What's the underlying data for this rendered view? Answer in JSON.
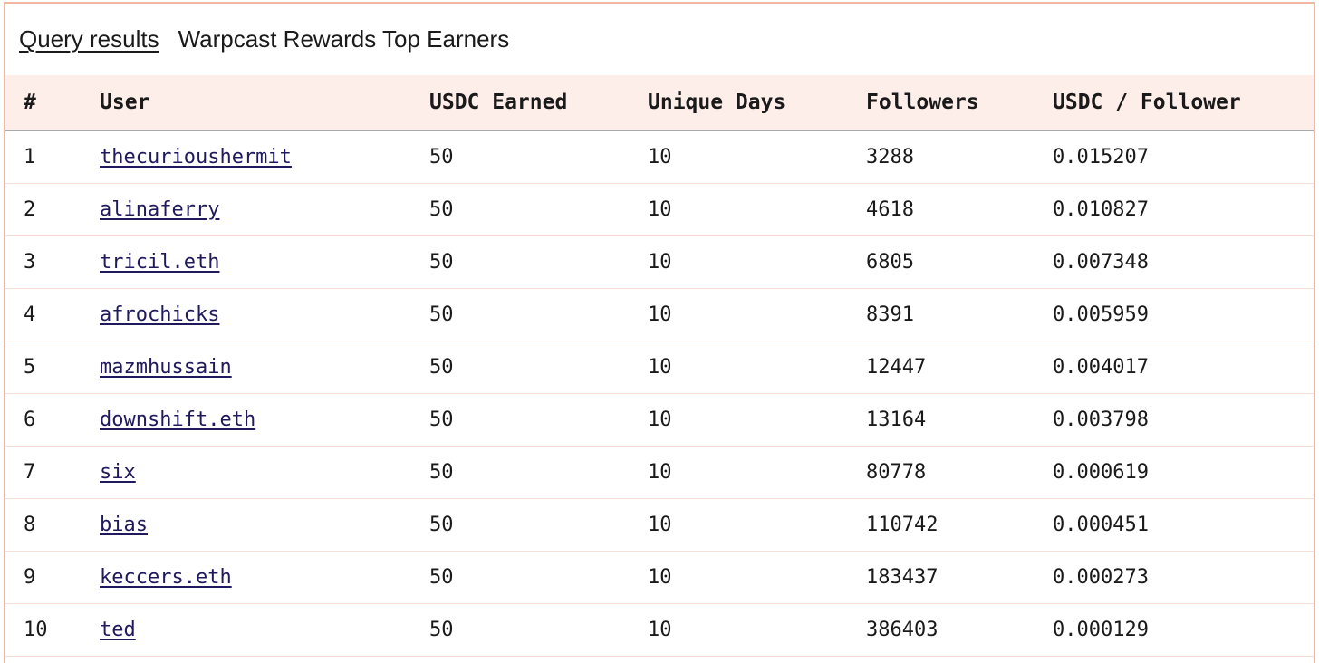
{
  "header": {
    "link_label": "Query results",
    "title": "Warpcast Rewards Top Earners"
  },
  "table": {
    "columns": [
      "#",
      "User",
      "USDC Earned",
      "Unique Days",
      "Followers",
      "USDC / Follower"
    ],
    "rows": [
      {
        "rank": "1",
        "user": "thecurioushermit",
        "usdc": "50",
        "days": "10",
        "followers": "3288",
        "ratio": "0.015207"
      },
      {
        "rank": "2",
        "user": "alinaferry",
        "usdc": "50",
        "days": "10",
        "followers": "4618",
        "ratio": "0.010827"
      },
      {
        "rank": "3",
        "user": "tricil.eth",
        "usdc": "50",
        "days": "10",
        "followers": "6805",
        "ratio": "0.007348"
      },
      {
        "rank": "4",
        "user": "afrochicks",
        "usdc": "50",
        "days": "10",
        "followers": "8391",
        "ratio": "0.005959"
      },
      {
        "rank": "5",
        "user": "mazmhussain",
        "usdc": "50",
        "days": "10",
        "followers": "12447",
        "ratio": "0.004017"
      },
      {
        "rank": "6",
        "user": "downshift.eth",
        "usdc": "50",
        "days": "10",
        "followers": "13164",
        "ratio": "0.003798"
      },
      {
        "rank": "7",
        "user": "six",
        "usdc": "50",
        "days": "10",
        "followers": "80778",
        "ratio": "0.000619"
      },
      {
        "rank": "8",
        "user": "bias",
        "usdc": "50",
        "days": "10",
        "followers": "110742",
        "ratio": "0.000451"
      },
      {
        "rank": "9",
        "user": "keccers.eth",
        "usdc": "50",
        "days": "10",
        "followers": "183437",
        "ratio": "0.000273"
      },
      {
        "rank": "10",
        "user": "ted",
        "usdc": "50",
        "days": "10",
        "followers": "386403",
        "ratio": "0.000129"
      }
    ]
  },
  "colors": {
    "border": "#f3b8a4",
    "header_bg": "#fdeeea",
    "link": "#1f1a5e"
  }
}
